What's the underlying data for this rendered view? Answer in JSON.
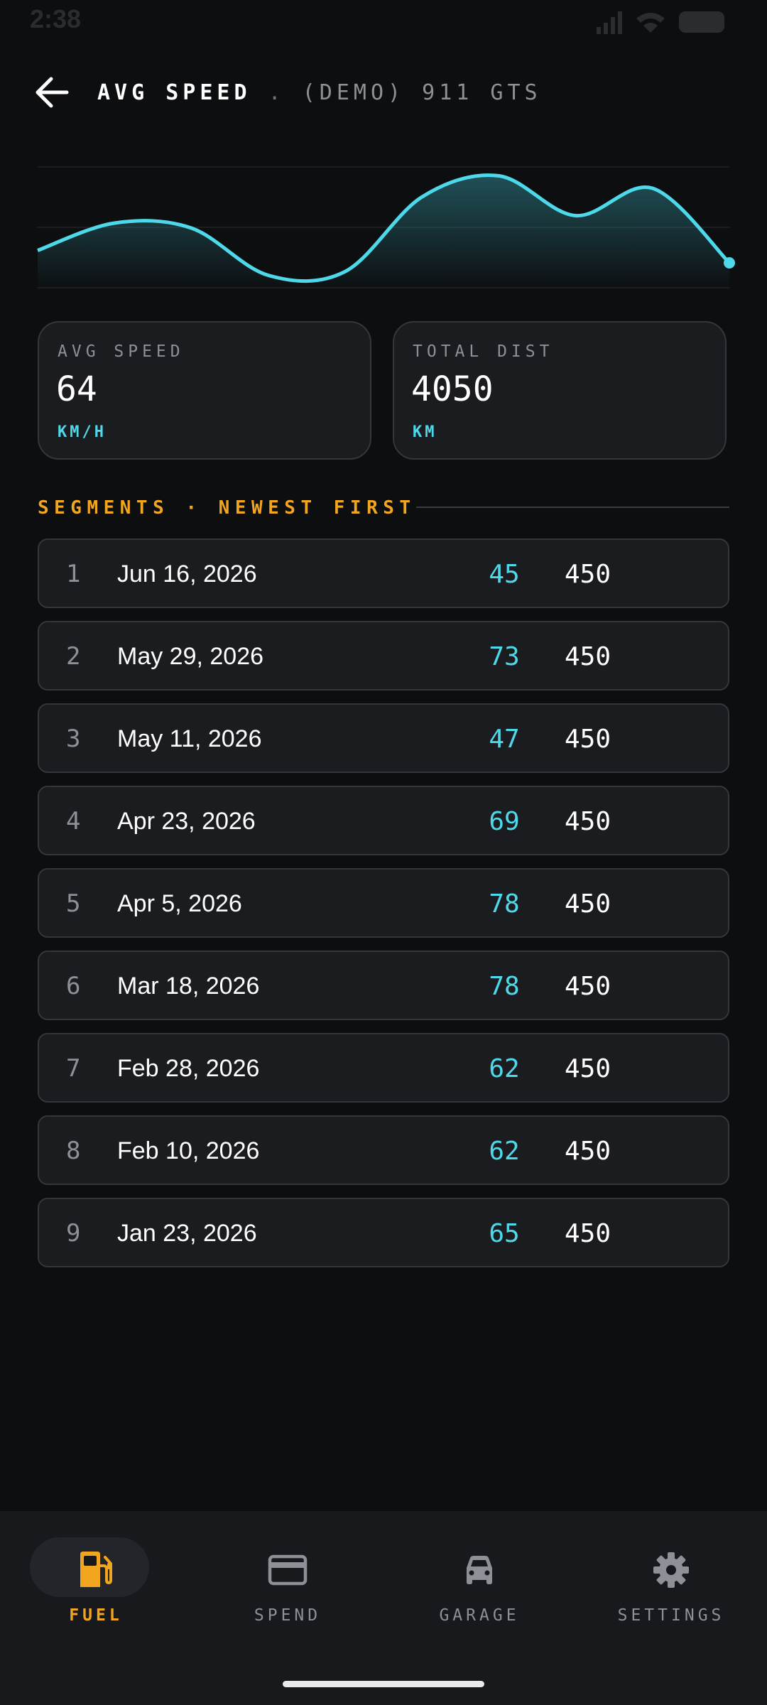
{
  "status_bar": {
    "time": "2:38"
  },
  "header": {
    "title": "AVG SPEED",
    "separator": ".",
    "subtitle": "(DEMO) 911 GTS"
  },
  "chart_data": {
    "type": "area",
    "points": [
      0.3,
      0.52,
      0.48,
      0.1,
      0.13,
      0.73,
      0.9,
      0.58,
      0.8,
      0.2
    ],
    "color": "#4dd9ea"
  },
  "stats": [
    {
      "label": "AVG SPEED",
      "value": "64",
      "unit": "KM/H"
    },
    {
      "label": "TOTAL DIST",
      "value": "4050",
      "unit": "KM"
    }
  ],
  "section": {
    "title": "SEGMENTS · NEWEST FIRST"
  },
  "segments": [
    {
      "index": "1",
      "date": "Jun 16, 2026",
      "speed": "45",
      "distance": "450"
    },
    {
      "index": "2",
      "date": "May 29, 2026",
      "speed": "73",
      "distance": "450"
    },
    {
      "index": "3",
      "date": "May 11, 2026",
      "speed": "47",
      "distance": "450"
    },
    {
      "index": "4",
      "date": "Apr 23, 2026",
      "speed": "69",
      "distance": "450"
    },
    {
      "index": "5",
      "date": "Apr 5, 2026",
      "speed": "78",
      "distance": "450"
    },
    {
      "index": "6",
      "date": "Mar 18, 2026",
      "speed": "78",
      "distance": "450"
    },
    {
      "index": "7",
      "date": "Feb 28, 2026",
      "speed": "62",
      "distance": "450"
    },
    {
      "index": "8",
      "date": "Feb 10, 2026",
      "speed": "62",
      "distance": "450"
    },
    {
      "index": "9",
      "date": "Jan 23, 2026",
      "speed": "65",
      "distance": "450"
    }
  ],
  "nav": [
    {
      "label": "FUEL",
      "icon": "fuel-pump-icon",
      "active": true
    },
    {
      "label": "SPEND",
      "icon": "credit-card-icon",
      "active": false
    },
    {
      "label": "GARAGE",
      "icon": "car-icon",
      "active": false
    },
    {
      "label": "SETTINGS",
      "icon": "gear-icon",
      "active": false
    }
  ],
  "colors": {
    "accent": "#4dd9ea",
    "highlight": "#f2a51e",
    "background": "#0d0e10",
    "card": "#1b1c1f"
  }
}
